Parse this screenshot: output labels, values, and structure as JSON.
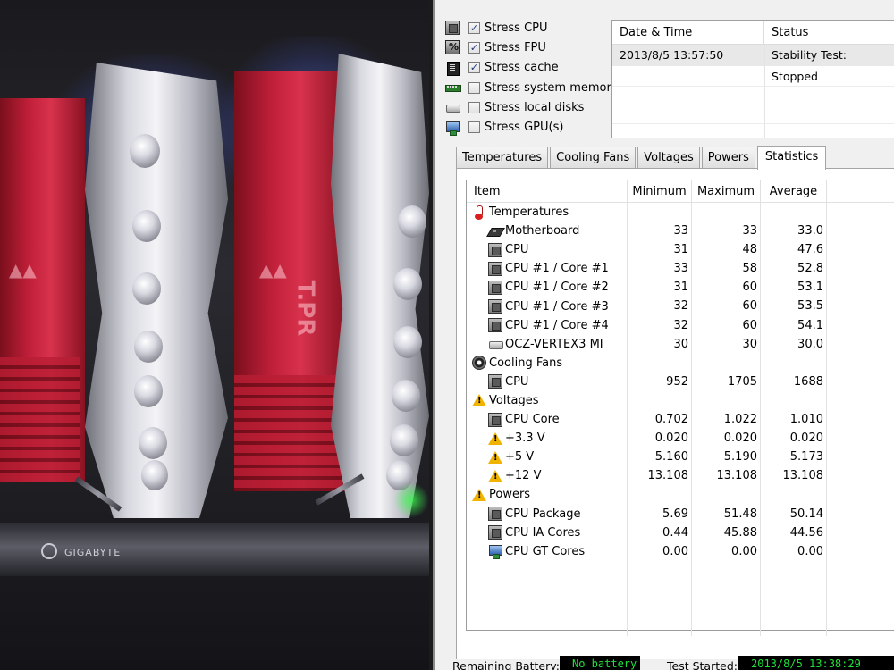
{
  "stress_options": [
    {
      "label": "Stress CPU",
      "checked": true,
      "icon": "cpu-chip-icon"
    },
    {
      "label": "Stress FPU",
      "checked": true,
      "icon": "fpu-chip-icon"
    },
    {
      "label": "Stress cache",
      "checked": true,
      "icon": "cache-chip-icon"
    },
    {
      "label": "Stress system memory",
      "checked": false,
      "icon": "memory-module-icon"
    },
    {
      "label": "Stress local disks",
      "checked": false,
      "icon": "disk-drive-icon"
    },
    {
      "label": "Stress GPU(s)",
      "checked": false,
      "icon": "gpu-monitor-icon"
    }
  ],
  "status_table": {
    "headers": {
      "date_time": "Date & Time",
      "status": "Status"
    },
    "row": {
      "date_time": "2013/8/5 13:57:50",
      "status": "Stability Test: Stopped"
    }
  },
  "tabs": [
    "Temperatures",
    "Cooling Fans",
    "Voltages",
    "Powers",
    "Statistics"
  ],
  "active_tab": "Statistics",
  "stats": {
    "headers": {
      "item": "Item",
      "minimum": "Minimum",
      "maximum": "Maximum",
      "average": "Average"
    },
    "rows": [
      {
        "name": "Temperatures",
        "level": 1,
        "icon": "thermometer-icon",
        "min": "",
        "max": "",
        "avg": ""
      },
      {
        "name": "Motherboard",
        "level": 2,
        "icon": "motherboard-icon",
        "min": "33",
        "max": "33",
        "avg": "33.0"
      },
      {
        "name": "CPU",
        "level": 2,
        "icon": "chip-icon",
        "min": "31",
        "max": "48",
        "avg": "47.6"
      },
      {
        "name": "CPU #1 / Core #1",
        "level": 2,
        "icon": "chip-icon",
        "min": "33",
        "max": "58",
        "avg": "52.8"
      },
      {
        "name": "CPU #1 / Core #2",
        "level": 2,
        "icon": "chip-icon",
        "min": "31",
        "max": "60",
        "avg": "53.1"
      },
      {
        "name": "CPU #1 / Core #3",
        "level": 2,
        "icon": "chip-icon",
        "min": "32",
        "max": "60",
        "avg": "53.5"
      },
      {
        "name": "CPU #1 / Core #4",
        "level": 2,
        "icon": "chip-icon",
        "min": "32",
        "max": "60",
        "avg": "54.1"
      },
      {
        "name": "OCZ-VERTEX3 MI",
        "level": 2,
        "icon": "disk-icon",
        "min": "30",
        "max": "30",
        "avg": "30.0"
      },
      {
        "name": "Cooling Fans",
        "level": 1,
        "icon": "fan-icon",
        "min": "",
        "max": "",
        "avg": ""
      },
      {
        "name": "CPU",
        "level": 2,
        "icon": "chip-icon",
        "min": "952",
        "max": "1705",
        "avg": "1688"
      },
      {
        "name": "Voltages",
        "level": 1,
        "icon": "warning-icon",
        "min": "",
        "max": "",
        "avg": ""
      },
      {
        "name": "CPU Core",
        "level": 2,
        "icon": "chip-icon",
        "min": "0.702",
        "max": "1.022",
        "avg": "1.010"
      },
      {
        "name": "+3.3 V",
        "level": 2,
        "icon": "warning-icon",
        "min": "0.020",
        "max": "0.020",
        "avg": "0.020"
      },
      {
        "name": "+5 V",
        "level": 2,
        "icon": "warning-icon",
        "min": "5.160",
        "max": "5.190",
        "avg": "5.173"
      },
      {
        "name": "+12 V",
        "level": 2,
        "icon": "warning-icon",
        "min": "13.108",
        "max": "13.108",
        "avg": "13.108"
      },
      {
        "name": "Powers",
        "level": 1,
        "icon": "warning-icon",
        "min": "",
        "max": "",
        "avg": ""
      },
      {
        "name": "CPU Package",
        "level": 2,
        "icon": "chip-icon",
        "min": "5.69",
        "max": "51.48",
        "avg": "50.14"
      },
      {
        "name": "CPU IA Cores",
        "level": 2,
        "icon": "chip-icon",
        "min": "0.44",
        "max": "45.88",
        "avg": "44.56"
      },
      {
        "name": "CPU GT Cores",
        "level": 2,
        "icon": "gpu-icon",
        "min": "0.00",
        "max": "0.00",
        "avg": "0.00"
      }
    ]
  },
  "footer": {
    "battery_label": "Remaining Battery:",
    "battery_value": "No battery",
    "test_started_label": "Test Started:",
    "test_started_value": "2013/8/5 13:38:29"
  },
  "colors": {
    "window_bg": "#f0f0f0",
    "readout_bg": "#000000",
    "readout_text": "#1fe23c",
    "warning": "#f0b400"
  }
}
